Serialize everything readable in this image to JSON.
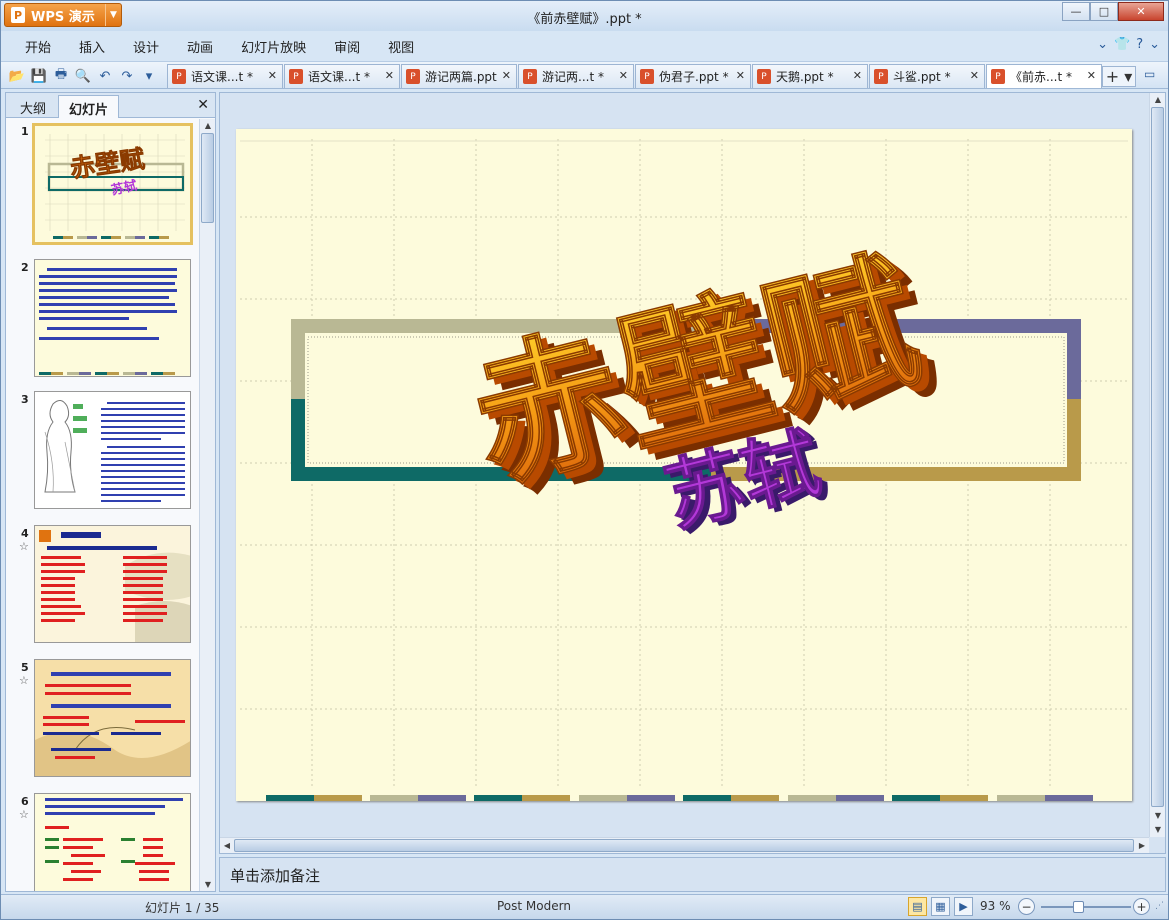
{
  "app": {
    "name": "WPS 演示",
    "document_title": "《前赤壁赋》.ppt *"
  },
  "window_controls": {
    "minimize": "—",
    "maximize": "□",
    "close": "✕"
  },
  "menu": [
    "开始",
    "插入",
    "设计",
    "动画",
    "幻灯片放映",
    "审阅",
    "视图"
  ],
  "quick_access_icons": [
    "open-icon",
    "save-icon",
    "print-icon",
    "print-preview-icon",
    "undo-icon",
    "redo-icon",
    "customize-icon"
  ],
  "doc_tabs": [
    {
      "label": "语文课...t *",
      "active": false
    },
    {
      "label": "语文课...t *",
      "active": false
    },
    {
      "label": "游记两篇.ppt",
      "active": false
    },
    {
      "label": "游记两...t *",
      "active": false
    },
    {
      "label": "伪君子.ppt *",
      "active": false
    },
    {
      "label": "天鹅.ppt *",
      "active": false
    },
    {
      "label": "斗鲨.ppt *",
      "active": false
    },
    {
      "label": "《前赤...t *",
      "active": true
    }
  ],
  "left_panel": {
    "tabs": [
      "大纲",
      "幻灯片"
    ],
    "active_tab": "幻灯片",
    "slides": [
      {
        "num": "1",
        "star": false,
        "selected": true
      },
      {
        "num": "2",
        "star": false,
        "selected": false
      },
      {
        "num": "3",
        "star": false,
        "selected": false
      },
      {
        "num": "4",
        "star": true,
        "selected": false
      },
      {
        "num": "5",
        "star": true,
        "selected": false
      },
      {
        "num": "6",
        "star": true,
        "selected": false
      }
    ]
  },
  "slide": {
    "title": "赤壁赋",
    "subtitle": "苏轼",
    "background": "#fdfbdc"
  },
  "notes_placeholder": "单击添加备注",
  "status": {
    "slides": "幻灯片 1 / 35",
    "theme": "Post Modern",
    "zoom": "93 %",
    "zoom_percent": 93
  },
  "colors": {
    "accent_orange": "#e07310",
    "teal": "#0e6a66",
    "slate": "#6b6a9b",
    "khaki": "#b9b894",
    "gold": "#b99a4a"
  }
}
